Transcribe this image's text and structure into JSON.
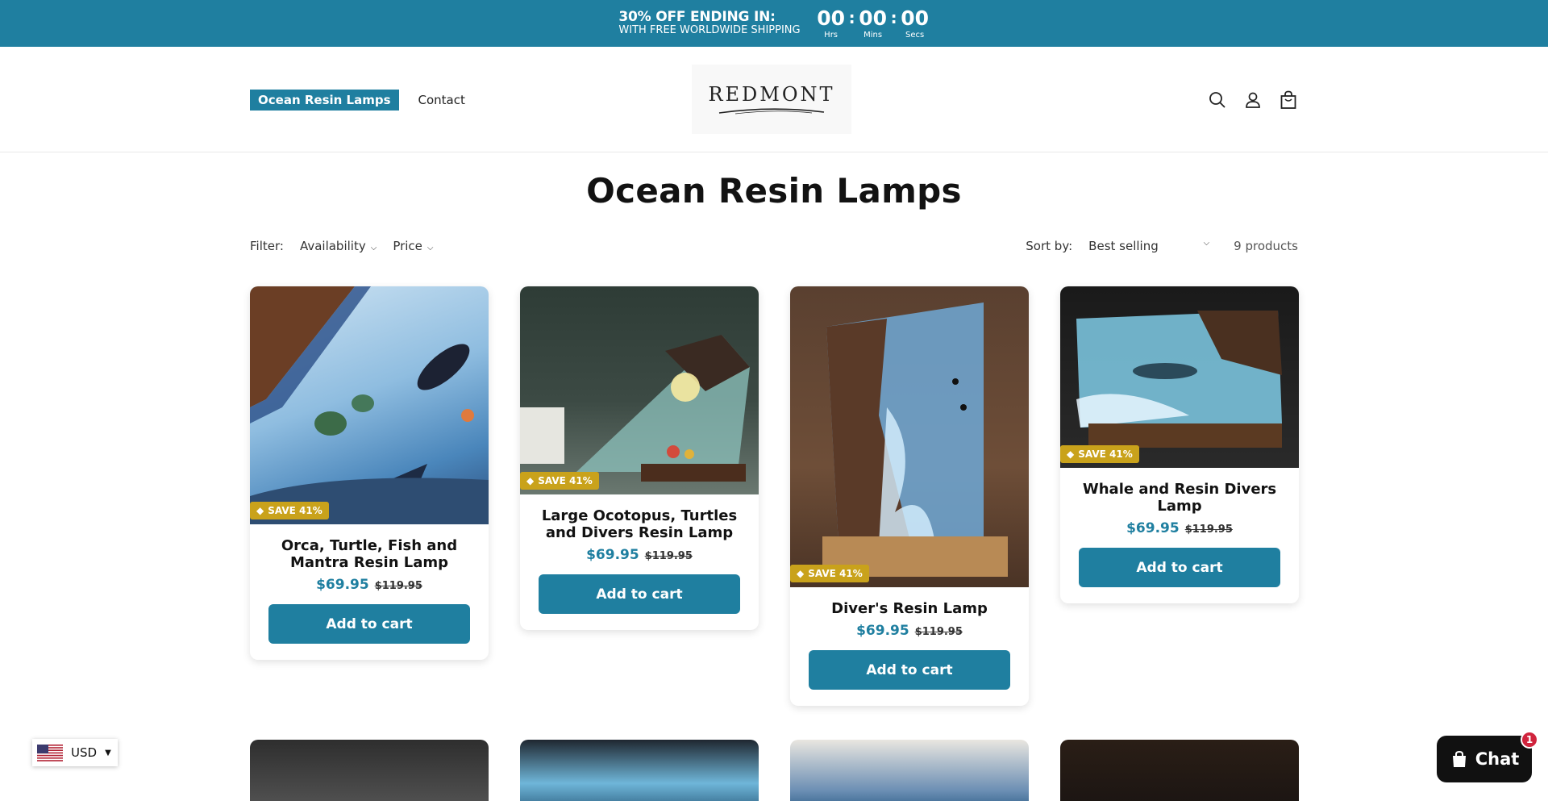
{
  "announcement": {
    "line1": "30% OFF ENDING IN:",
    "line2": "WITH FREE WORLDWIDE SHIPPING",
    "timer": [
      {
        "value": "00",
        "label": "Hrs"
      },
      {
        "value": "00",
        "label": "Mins"
      },
      {
        "value": "00",
        "label": "Secs"
      }
    ],
    "bg_color": "#1f7fa0"
  },
  "header": {
    "nav": [
      {
        "label": "Ocean Resin Lamps"
      },
      {
        "label": "Contact"
      }
    ],
    "logo": "REDMONT",
    "icons": [
      "search-icon",
      "account-icon",
      "cart-icon"
    ]
  },
  "page": {
    "title": "Ocean Resin Lamps"
  },
  "filters": {
    "label": "Filter:",
    "availability": "Availability",
    "price": "Price",
    "sort_label": "Sort by:",
    "sort_value": "Best selling",
    "count": "9 products"
  },
  "products": [
    {
      "badge": "SAVE 41%",
      "title": "Orca, Turtle, Fish and Mantra Resin Lamp",
      "price": "$69.95",
      "compare": "$119.95",
      "cta": "Add to cart"
    },
    {
      "badge": "SAVE 41%",
      "title": "Large Ocotopus, Turtles and Divers Resin Lamp",
      "price": "$69.95",
      "compare": "$119.95",
      "cta": "Add to cart"
    },
    {
      "badge": "SAVE 41%",
      "title": "Diver's Resin Lamp",
      "price": "$69.95",
      "compare": "$119.95",
      "cta": "Add to cart"
    },
    {
      "badge": "SAVE 41%",
      "title": "Whale and Resin Divers Lamp",
      "price": "$69.95",
      "compare": "$119.95",
      "cta": "Add to cart"
    }
  ],
  "currency": {
    "code": "USD"
  },
  "chat": {
    "label": "Chat",
    "unread": "1"
  },
  "colors": {
    "accent": "#1f7fa0",
    "badge": "#c9a21b"
  }
}
